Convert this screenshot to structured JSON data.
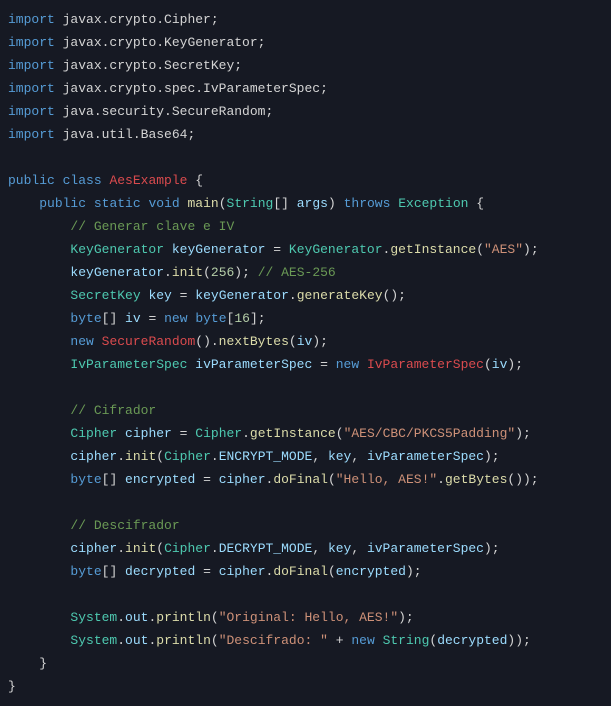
{
  "lines": {
    "l1_kw": "import",
    "l1_pkg": "javax.crypto.Cipher",
    "l2_kw": "import",
    "l2_pkg": "javax.crypto.KeyGenerator",
    "l3_kw": "import",
    "l3_pkg": "javax.crypto.SecretKey",
    "l4_kw": "import",
    "l4_pkg": "javax.crypto.spec.IvParameterSpec",
    "l5_kw": "import",
    "l5_pkg": "java.security.SecureRandom",
    "l6_kw": "import",
    "l6_pkg": "java.util.Base64",
    "l8_public": "public",
    "l8_class": "class",
    "l8_name": "AesExample",
    "l9_public": "public",
    "l9_static": "static",
    "l9_void": "void",
    "l9_main": "main",
    "l9_string": "String",
    "l9_args": "args",
    "l9_throws": "throws",
    "l9_exc": "Exception",
    "l10_cmt": "// Generar clave e IV",
    "l11_type": "KeyGenerator",
    "l11_var": "keyGenerator",
    "l11_rtype": "KeyGenerator",
    "l11_method": "getInstance",
    "l11_str": "\"AES\"",
    "l12_var": "keyGenerator",
    "l12_method": "init",
    "l12_num": "256",
    "l12_cmt": "// AES-256",
    "l13_type": "SecretKey",
    "l13_var": "key",
    "l13_rvar": "keyGenerator",
    "l13_method": "generateKey",
    "l14_byte": "byte",
    "l14_var": "iv",
    "l14_new": "new",
    "l14_byte2": "byte",
    "l14_num": "16",
    "l15_new": "new",
    "l15_type": "SecureRandom",
    "l15_method": "nextBytes",
    "l15_arg": "iv",
    "l16_type": "IvParameterSpec",
    "l16_var": "ivParameterSpec",
    "l16_new": "new",
    "l16_rtype": "IvParameterSpec",
    "l16_arg": "iv",
    "l18_cmt": "// Cifrador",
    "l19_type": "Cipher",
    "l19_var": "cipher",
    "l19_rtype": "Cipher",
    "l19_method": "getInstance",
    "l19_str": "\"AES/CBC/PKCS5Padding\"",
    "l20_var": "cipher",
    "l20_method": "init",
    "l20_rtype": "Cipher",
    "l20_const": "ENCRYPT_MODE",
    "l20_a2": "key",
    "l20_a3": "ivParameterSpec",
    "l21_byte": "byte",
    "l21_var": "encrypted",
    "l21_rvar": "cipher",
    "l21_method": "doFinal",
    "l21_str": "\"Hello, AES!\"",
    "l21_method2": "getBytes",
    "l23_cmt": "// Descifrador",
    "l24_var": "cipher",
    "l24_method": "init",
    "l24_rtype": "Cipher",
    "l24_const": "DECRYPT_MODE",
    "l24_a2": "key",
    "l24_a3": "ivParameterSpec",
    "l25_byte": "byte",
    "l25_var": "decrypted",
    "l25_rvar": "cipher",
    "l25_method": "doFinal",
    "l25_arg": "encrypted",
    "l27_sys": "System",
    "l27_out": "out",
    "l27_method": "println",
    "l27_str": "\"Original: Hello, AES!\"",
    "l28_sys": "System",
    "l28_out": "out",
    "l28_method": "println",
    "l28_str": "\"Descifrado: \"",
    "l28_new": "new",
    "l28_type": "String",
    "l28_arg": "decrypted"
  }
}
